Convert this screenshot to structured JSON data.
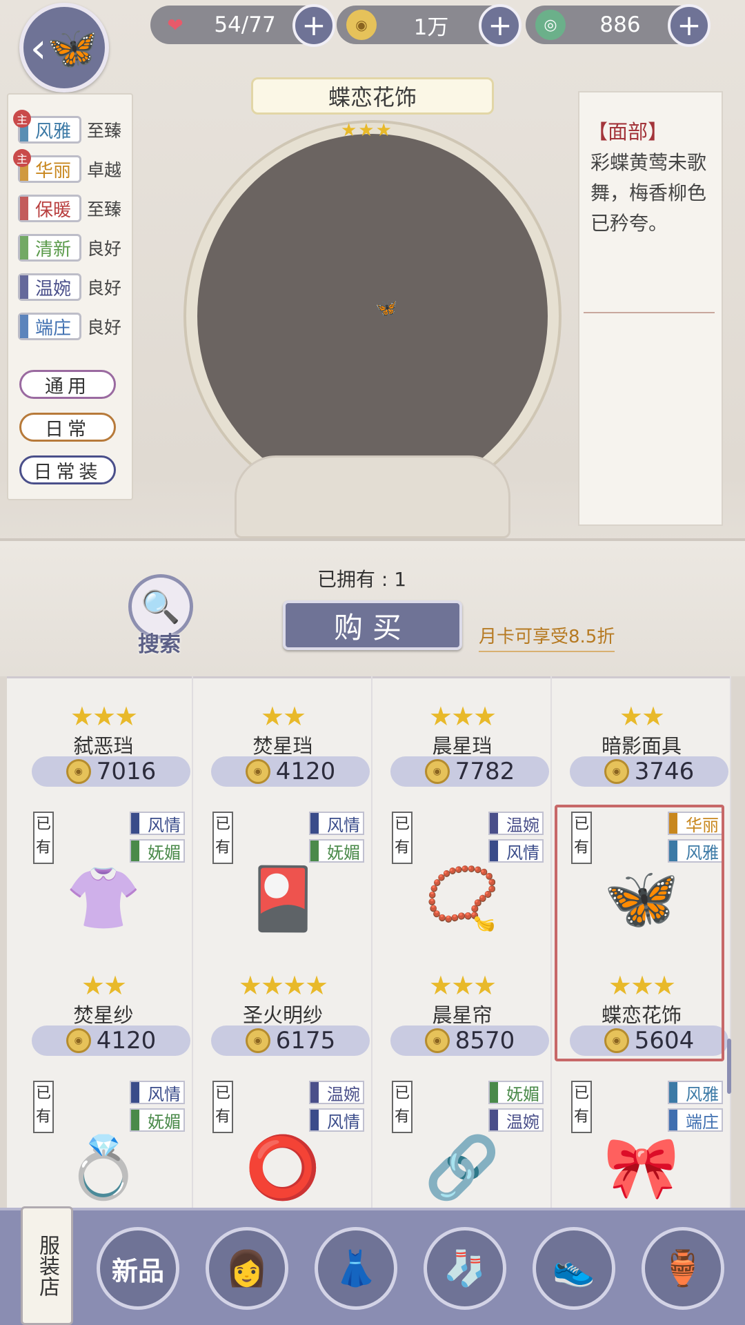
{
  "resources": [
    {
      "name": "heart",
      "icon": "heart-icon",
      "symbol": "❤",
      "value": "54/77",
      "color": "#e85a6a"
    },
    {
      "name": "coin",
      "icon": "coin-icon",
      "symbol": "◉",
      "value": "1万",
      "color": "#e6c25a"
    },
    {
      "name": "jade",
      "icon": "jade-icon",
      "symbol": "◎",
      "value": "886",
      "color": "#6bb08a"
    }
  ],
  "attributes": [
    {
      "label": "风雅",
      "grade": "至臻",
      "main": true,
      "color": "#3c7aa6"
    },
    {
      "label": "华丽",
      "grade": "卓越",
      "main": true,
      "color": "#c8871e"
    },
    {
      "label": "保暖",
      "grade": "至臻",
      "main": false,
      "color": "#b94040"
    },
    {
      "label": "清新",
      "grade": "良好",
      "main": false,
      "color": "#5a9a4a"
    },
    {
      "label": "温婉",
      "grade": "良好",
      "main": false,
      "color": "#4a4f8a"
    },
    {
      "label": "端庄",
      "grade": "良好",
      "main": false,
      "color": "#3f6fb0"
    }
  ],
  "main_badge": "主",
  "scene_tags": [
    {
      "label": "通用",
      "color": "#9a6aa0"
    },
    {
      "label": "日常",
      "color": "#b77a3a"
    },
    {
      "label": "日常装",
      "color": "#4a4f8a"
    }
  ],
  "item": {
    "title": "蝶恋花饰",
    "stars": "★★★",
    "category": "【面部】",
    "description": "彩蝶黄莺未歌舞，梅香柳色已矜夸。"
  },
  "owned_text": "已拥有 : 1",
  "buy_label": "购买",
  "discount_text": "月卡可享受8.5折",
  "search_label": "搜索",
  "owned_badge": "已有",
  "shop_items": [
    {
      "stars": "★★★",
      "name": "弑恶珰",
      "price": "7016",
      "tags": [
        {
          "label": "风情",
          "color": "#3a4c8a"
        },
        {
          "label": "妩媚",
          "color": "#4a8a4a"
        }
      ],
      "image": "shirt-icon",
      "glyph": "👚",
      "selected": false
    },
    {
      "stars": "★★",
      "name": "焚星珰",
      "price": "4120",
      "tags": [
        {
          "label": "风情",
          "color": "#3a4c8a"
        },
        {
          "label": "妩媚",
          "color": "#4a8a4a"
        }
      ],
      "image": "veil-icon",
      "glyph": "🎴",
      "selected": false
    },
    {
      "stars": "★★★",
      "name": "晨星珰",
      "price": "7782",
      "tags": [
        {
          "label": "温婉",
          "color": "#4a4f8a"
        },
        {
          "label": "风情",
          "color": "#3a4c8a"
        }
      ],
      "image": "necklace-icon",
      "glyph": "📿",
      "selected": false
    },
    {
      "stars": "★★",
      "name": "暗影面具",
      "price": "3746",
      "tags": [
        {
          "label": "华丽",
          "color": "#c8871e"
        },
        {
          "label": "风雅",
          "color": "#3c7aa6"
        }
      ],
      "image": "butterfly-icon",
      "glyph": "🦋",
      "selected": true
    },
    {
      "stars": "★★",
      "name": "焚星纱",
      "price": "4120",
      "tags": [
        {
          "label": "风情",
          "color": "#3a4c8a"
        },
        {
          "label": "妩媚",
          "color": "#4a8a4a"
        }
      ],
      "image": "jewelry-icon",
      "glyph": "💍",
      "selected": false
    },
    {
      "stars": "★★★★",
      "name": "圣火明纱",
      "price": "6175",
      "tags": [
        {
          "label": "温婉",
          "color": "#4a4f8a"
        },
        {
          "label": "风情",
          "color": "#3a4c8a"
        }
      ],
      "image": "choker-icon",
      "glyph": "⭕",
      "selected": false
    },
    {
      "stars": "★★★",
      "name": "晨星帘",
      "price": "8570",
      "tags": [
        {
          "label": "妩媚",
          "color": "#4a8a4a"
        },
        {
          "label": "温婉",
          "color": "#4a4f8a"
        }
      ],
      "image": "chain-icon",
      "glyph": "🔗",
      "selected": false
    },
    {
      "stars": "★★★",
      "name": "蝶恋花饰",
      "price": "5604",
      "tags": [
        {
          "label": "风雅",
          "color": "#3c7aa6"
        },
        {
          "label": "端庄",
          "color": "#3f6fb0"
        }
      ],
      "image": "collar-icon",
      "glyph": "🎀",
      "selected": false
    }
  ],
  "nav": {
    "shop_label": "服装店",
    "new_label": "新品",
    "items": [
      {
        "name": "hair",
        "glyph": "👩"
      },
      {
        "name": "dress",
        "glyph": "👗"
      },
      {
        "name": "socks",
        "glyph": "🧦"
      },
      {
        "name": "shoes",
        "glyph": "👟"
      },
      {
        "name": "accessory",
        "glyph": "🏺"
      }
    ]
  }
}
